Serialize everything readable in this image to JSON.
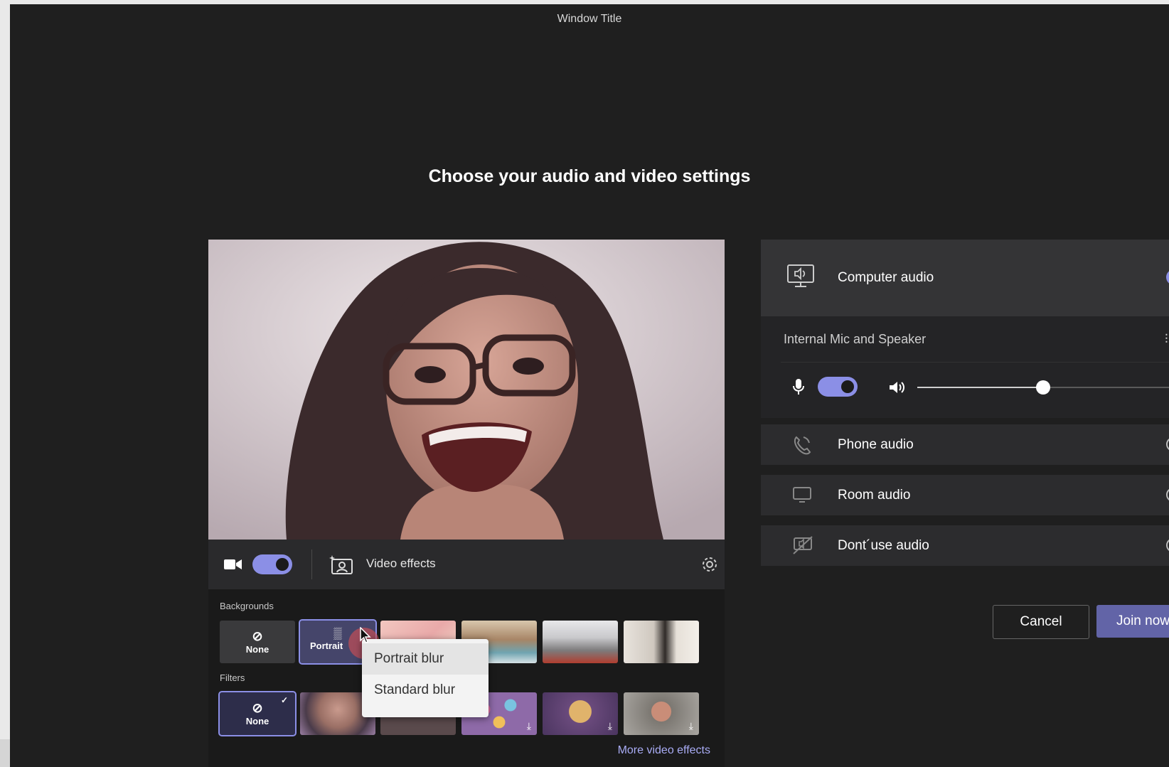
{
  "window": {
    "title": "Window Title"
  },
  "page": {
    "heading": "Choose your audio and video settings"
  },
  "video": {
    "camera_on": true,
    "effects_label": "Video effects",
    "backgrounds_label": "Backgrounds",
    "filters_label": "Filters",
    "none_label": "None",
    "portrait_label": "Portrait",
    "more_effects_label": "More video effects",
    "blur_menu": [
      "Portrait blur",
      "Standard blur"
    ]
  },
  "audio": {
    "computer_audio": {
      "label": "Computer audio",
      "selected": true,
      "device": "Internal Mic and Speaker",
      "mic_on": true,
      "volume_fraction": 0.48
    },
    "options": [
      {
        "label": "Phone audio",
        "icon": "phone-icon"
      },
      {
        "label": "Room audio",
        "icon": "monitor-icon"
      },
      {
        "label": "Dont´use audio",
        "icon": "audio-off-icon"
      }
    ]
  },
  "actions": {
    "cancel": "Cancel",
    "join": "Join now"
  },
  "colors": {
    "accent": "#8b8fe6",
    "background": "#1f1f1f",
    "panel": "#2c2c2e",
    "join": "#6264a7"
  }
}
